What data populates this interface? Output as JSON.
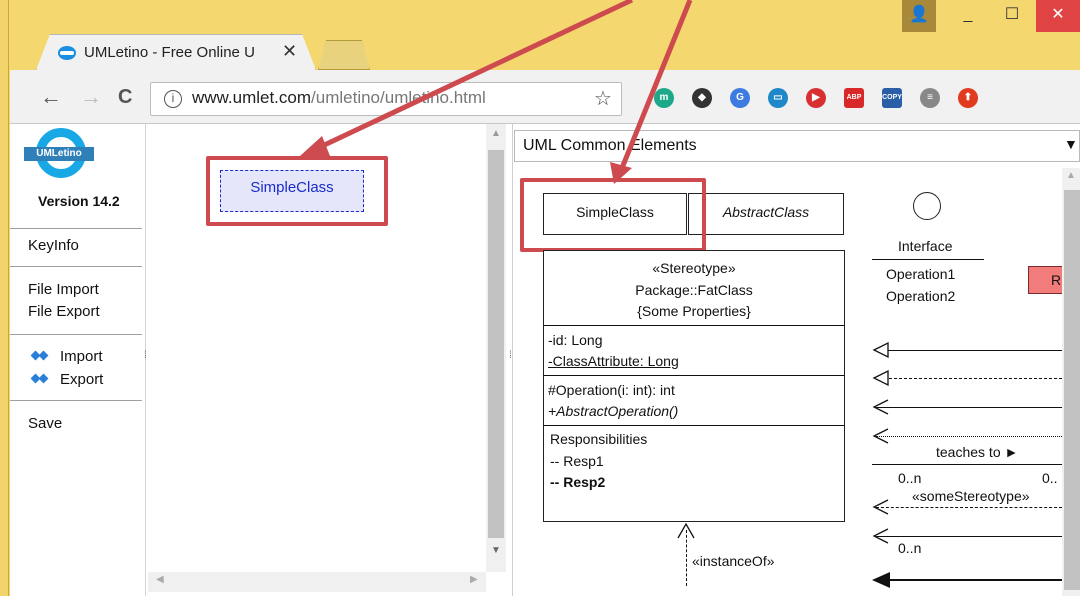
{
  "browser": {
    "tab_title": "UMLetino - Free Online U",
    "tab_close": "✕",
    "url_host": "www.umlet.com",
    "url_path": "/umletino/umletino.html",
    "back": "←",
    "forward": "→",
    "reload": "C",
    "star": "☆",
    "extensions": [
      {
        "name": "m",
        "color": "#1ea88a"
      },
      {
        "name": "◆",
        "color": "#333333"
      },
      {
        "name": "G",
        "color": "#3d7be0"
      },
      {
        "name": "▭",
        "color": "#1e88c8"
      },
      {
        "name": "▶",
        "color": "#d83030"
      },
      {
        "name": "ABP",
        "color": "#d82828"
      },
      {
        "name": "COPY",
        "color": "#2a5fa8"
      },
      {
        "name": "≡",
        "color": "#888888"
      },
      {
        "name": "⬆",
        "color": "#e23a1e"
      }
    ],
    "window_controls": {
      "minimize": "_",
      "maximize": "☐",
      "close": "✕",
      "user": "👤"
    }
  },
  "sidebar": {
    "logo_text": "UMLetino",
    "version": "Version 14.2",
    "keyinfo": "KeyInfo",
    "file_import": "File Import",
    "file_export": "File Export",
    "dropbox_import": "Import",
    "dropbox_export": "Export",
    "save": "Save"
  },
  "diagram": {
    "selected_element": "SimpleClass"
  },
  "palette": {
    "selected": "UML Common Elements",
    "simple_class": "SimpleClass",
    "abstract_class": "AbstractClass",
    "interface_label": "Interface",
    "interface_ops": [
      "Operation1",
      "Operation2"
    ],
    "fat_class": {
      "header": [
        "«Stereotype»",
        "Package::FatClass",
        "{Some Properties}"
      ],
      "attributes": [
        "-id: Long",
        "-ClassAttribute: Long"
      ],
      "operations": [
        "#Operation(i: int): int",
        "+AbstractOperation()"
      ],
      "responsibilities": [
        "Responsibilities",
        "-- Resp1",
        "-- Resp2"
      ]
    },
    "red_element": "R",
    "relations": {
      "teaches": "teaches to ►",
      "mult_left": "0..n",
      "mult_right": "0..",
      "stereotype": "«someStereotype»",
      "mult_bottom": "0..n",
      "instance_of": "«instanceOf»"
    }
  },
  "colors": {
    "highlight": "#cd4a4f",
    "selection_border": "#1a2cc9",
    "selection_fill": "#e6e6fa",
    "window_frame": "#f5d770"
  }
}
